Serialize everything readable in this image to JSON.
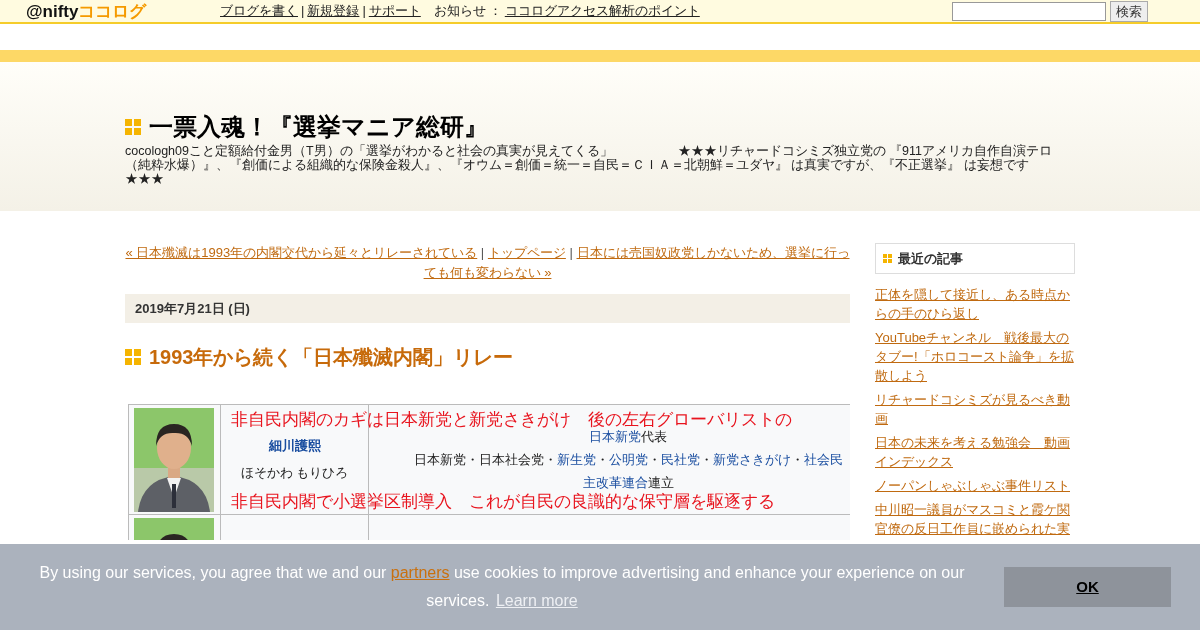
{
  "top_bar": {
    "logo": {
      "brand": "@nifty",
      "product": "ココログ"
    },
    "links": [
      {
        "label": "ブログを書く",
        "separator": "|"
      },
      {
        "label": "新規登録",
        "separator": "|"
      },
      {
        "label": "サポート"
      }
    ],
    "notice": {
      "label": "お知らせ",
      "separator": "：",
      "link": "ココログアクセス解析のポイント"
    },
    "search": {
      "button": "検索"
    }
  },
  "header": {
    "title": "一票入魂！『選挙マニア総研』",
    "description": "cocologh09こと定額給付金男（T男）の「選挙がわかると社会の真実が見えてくる」　　　　　★★★リチャードコシミズ独立党の 『911アメリカ自作自演テロ（純粋水爆）』、『創価による組織的な保険金殺人』、『オウム＝創価＝統一＝自民＝ＣＩＡ＝北朝鮮＝ユダヤ』 は真実ですが、『不正選挙』 は妄想です★★★"
  },
  "post_nav": {
    "previous": "« 日本殲滅は1993年の内閣交代から延々とリレーされている",
    "separator_1": "|",
    "top": "トップページ",
    "separator_2": "|",
    "next_lines": [
      "日本には売国奴政党しかないため、選挙に行っ",
      "ても何も変わらない »"
    ]
  },
  "date": "2019年7月21日 (日)",
  "post_title": "1993年から続く「日本殲滅内閣」リレー",
  "table": {
    "rows": [
      {
        "photo": {
          "kind": "picture"
        },
        "name": "細川護熙",
        "reading": "ほそかわ もりひろ",
        "lines": [
          [
            {
              "text": "日本新党",
              "link": true
            },
            {
              "text": "代表",
              "link": false
            }
          ],
          [
            {
              "text": "日本新党・日本社会党・",
              "link": false
            },
            {
              "text": "新生党",
              "link": true
            },
            {
              "text": "・",
              "link": false
            },
            {
              "text": "公明党",
              "link": true
            },
            {
              "text": "・",
              "link": false
            },
            {
              "text": "民社党",
              "link": true
            },
            {
              "text": "・",
              "link": false
            },
            {
              "text": "新党さきがけ",
              "link": true
            },
            {
              "text": "・",
              "link": false
            },
            {
              "text": "社会民",
              "link": true
            }
          ],
          [
            {
              "text": "主改革連合",
              "link": true
            },
            {
              "text": "連立",
              "link": false
            }
          ]
        ]
      },
      {
        "photo": {
          "kind": "picture"
        }
      }
    ],
    "captions": [
      "非自民内閣のカギは日本新党と新党さきがけ　後の左右グローバリストの",
      "非自民内閣で小選挙区制導入　これが自民の良識的な保守層を駆逐する"
    ]
  },
  "sidebar": {
    "title": "最近の記事",
    "items": [
      "正体を隠して接近し、ある時点からの手のひら返し",
      "YouTubeチャンネル　戦後最大のタブー!「ホロコースト論争」を拡散しよう",
      "リチャードコシミズが見るべき動画",
      "日本の未来を考える勉強会　動画インデックス",
      "ノーパンしゃぶしゃぶ事件リスト",
      "中川昭一議員がマスコミと霞ケ関官僚の反日工作員に嵌められた実"
    ]
  },
  "cookie_banner": {
    "before": "By using our services, you agree that we and our ",
    "link": "partners",
    "after": " use cookies to improve advertising and enhance your experience on our services.",
    "learn_more": "Learn more",
    "button": "OK"
  }
}
